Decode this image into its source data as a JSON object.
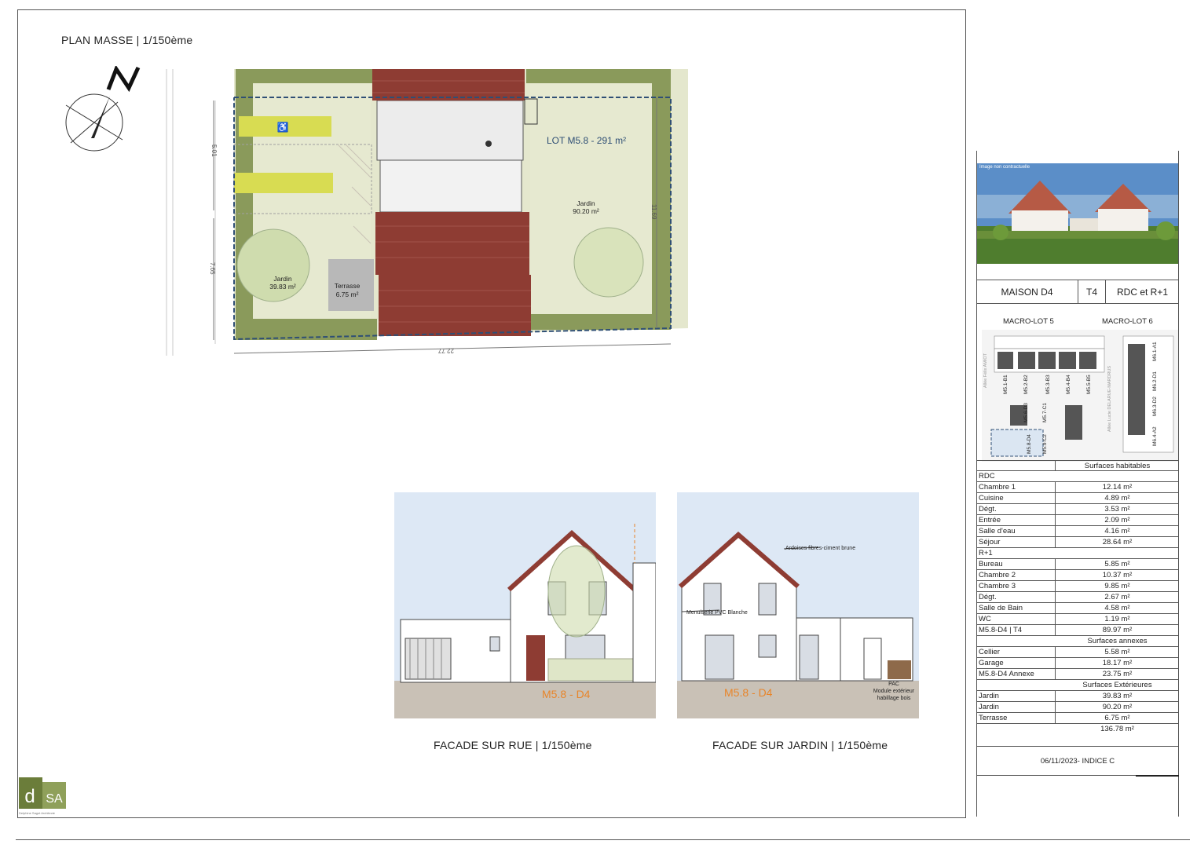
{
  "plan": {
    "title": "PLAN MASSE | 1/150ème",
    "lot_label": "LOT M5.8 - 291 m²",
    "garden_big_label": "Jardin",
    "garden_big_area": "90.20 m²",
    "garden_small_label": "Jardin",
    "garden_small_area": "39.83 m²",
    "terrace_label": "Terrasse",
    "terrace_area": "6.75 m²",
    "dim_top": "5.01",
    "dim_left": "7.65",
    "dim_right": "11.69",
    "dim_bottom": "22.77"
  },
  "facade_rue": {
    "caption": "FACADE SUR RUE | 1/150ème",
    "tag": "M5.8 - D4"
  },
  "facade_jardin": {
    "caption": "FACADE SUR JARDIN | 1/150ème",
    "tag": "M5.8 - D4",
    "note_roof": "Ardoises fibres-ciment brune",
    "note_joinery": "Menuiserie PVC Blanche",
    "note_pac_1": "PAC",
    "note_pac_2": "Module extérieur",
    "note_pac_3": "habillage bois"
  },
  "logo": {
    "mark": "dSA",
    "subtitle": "Delphine Sagot Architecte"
  },
  "info": {
    "image_note": "Image non contractuelle",
    "house": "MAISON D4",
    "type": "T4",
    "levels": "RDC et R+1",
    "macro_lot_5": "MACRO-LOT 5",
    "macro_lot_6": "MACRO-LOT 6",
    "street_1": "Allée Félix AMIOT",
    "street_2": "Allée Lucie DELARUE-MARDRUS",
    "keymap_lots": [
      "M5.1-B1",
      "M5.2-B2",
      "M5.3-B3",
      "M5.4-B4",
      "M5.5-B5",
      "M5.6-D3",
      "M5.7-C1",
      "M5.8-D4",
      "M5.9-C2",
      "M6.1-A1",
      "M6.2-D1",
      "M6.3-D2",
      "M6.4-A2"
    ]
  },
  "surfaces": {
    "habitable_title": "Surfaces habitables",
    "rdc_title": "RDC",
    "rdc": [
      {
        "label": "Chambre 1",
        "value": "12.14 m²"
      },
      {
        "label": "Cuisine",
        "value": "4.89 m²"
      },
      {
        "label": "Dégt.",
        "value": "3.53 m²"
      },
      {
        "label": "Entrée",
        "value": "2.09 m²"
      },
      {
        "label": "Salle d'eau",
        "value": "4.16 m²"
      },
      {
        "label": "Séjour",
        "value": "28.64 m²"
      }
    ],
    "r1_title": "R+1",
    "r1": [
      {
        "label": "Bureau",
        "value": "5.85 m²"
      },
      {
        "label": "Chambre 2",
        "value": "10.37 m²"
      },
      {
        "label": "Chambre 3",
        "value": "9.85 m²"
      },
      {
        "label": "Dégt.",
        "value": "2.67 m²"
      },
      {
        "label": "Salle de Bain",
        "value": "4.58 m²"
      },
      {
        "label": "WC",
        "value": "1.19 m²"
      },
      {
        "label": "M5.8-D4 | T4",
        "value": "89.97 m²"
      }
    ],
    "annex_title": "Surfaces annexes",
    "annex": [
      {
        "label": "Cellier",
        "value": "5.58 m²"
      },
      {
        "label": "Garage",
        "value": "18.17 m²"
      },
      {
        "label": "M5.8-D4 Annexe",
        "value": "23.75 m²"
      }
    ],
    "ext_title": "Surfaces Extérieures",
    "ext": [
      {
        "label": "Jardin",
        "value": "39.83 m²"
      },
      {
        "label": "Jardin",
        "value": "90.20 m²"
      },
      {
        "label": "Terrasse",
        "value": "6.75 m²"
      }
    ],
    "total": "136.78 m²"
  },
  "footer": {
    "date": "06/11/2023- INDICE C"
  },
  "colors": {
    "garden": "#dfe3c4",
    "hedge": "#8a9a5b",
    "roof_tile": "#8e3c33",
    "lot_line": "#2f4f75",
    "parking": "#d8dc52",
    "accent_orange": "#e8852a",
    "sky": "#dde8f5"
  }
}
